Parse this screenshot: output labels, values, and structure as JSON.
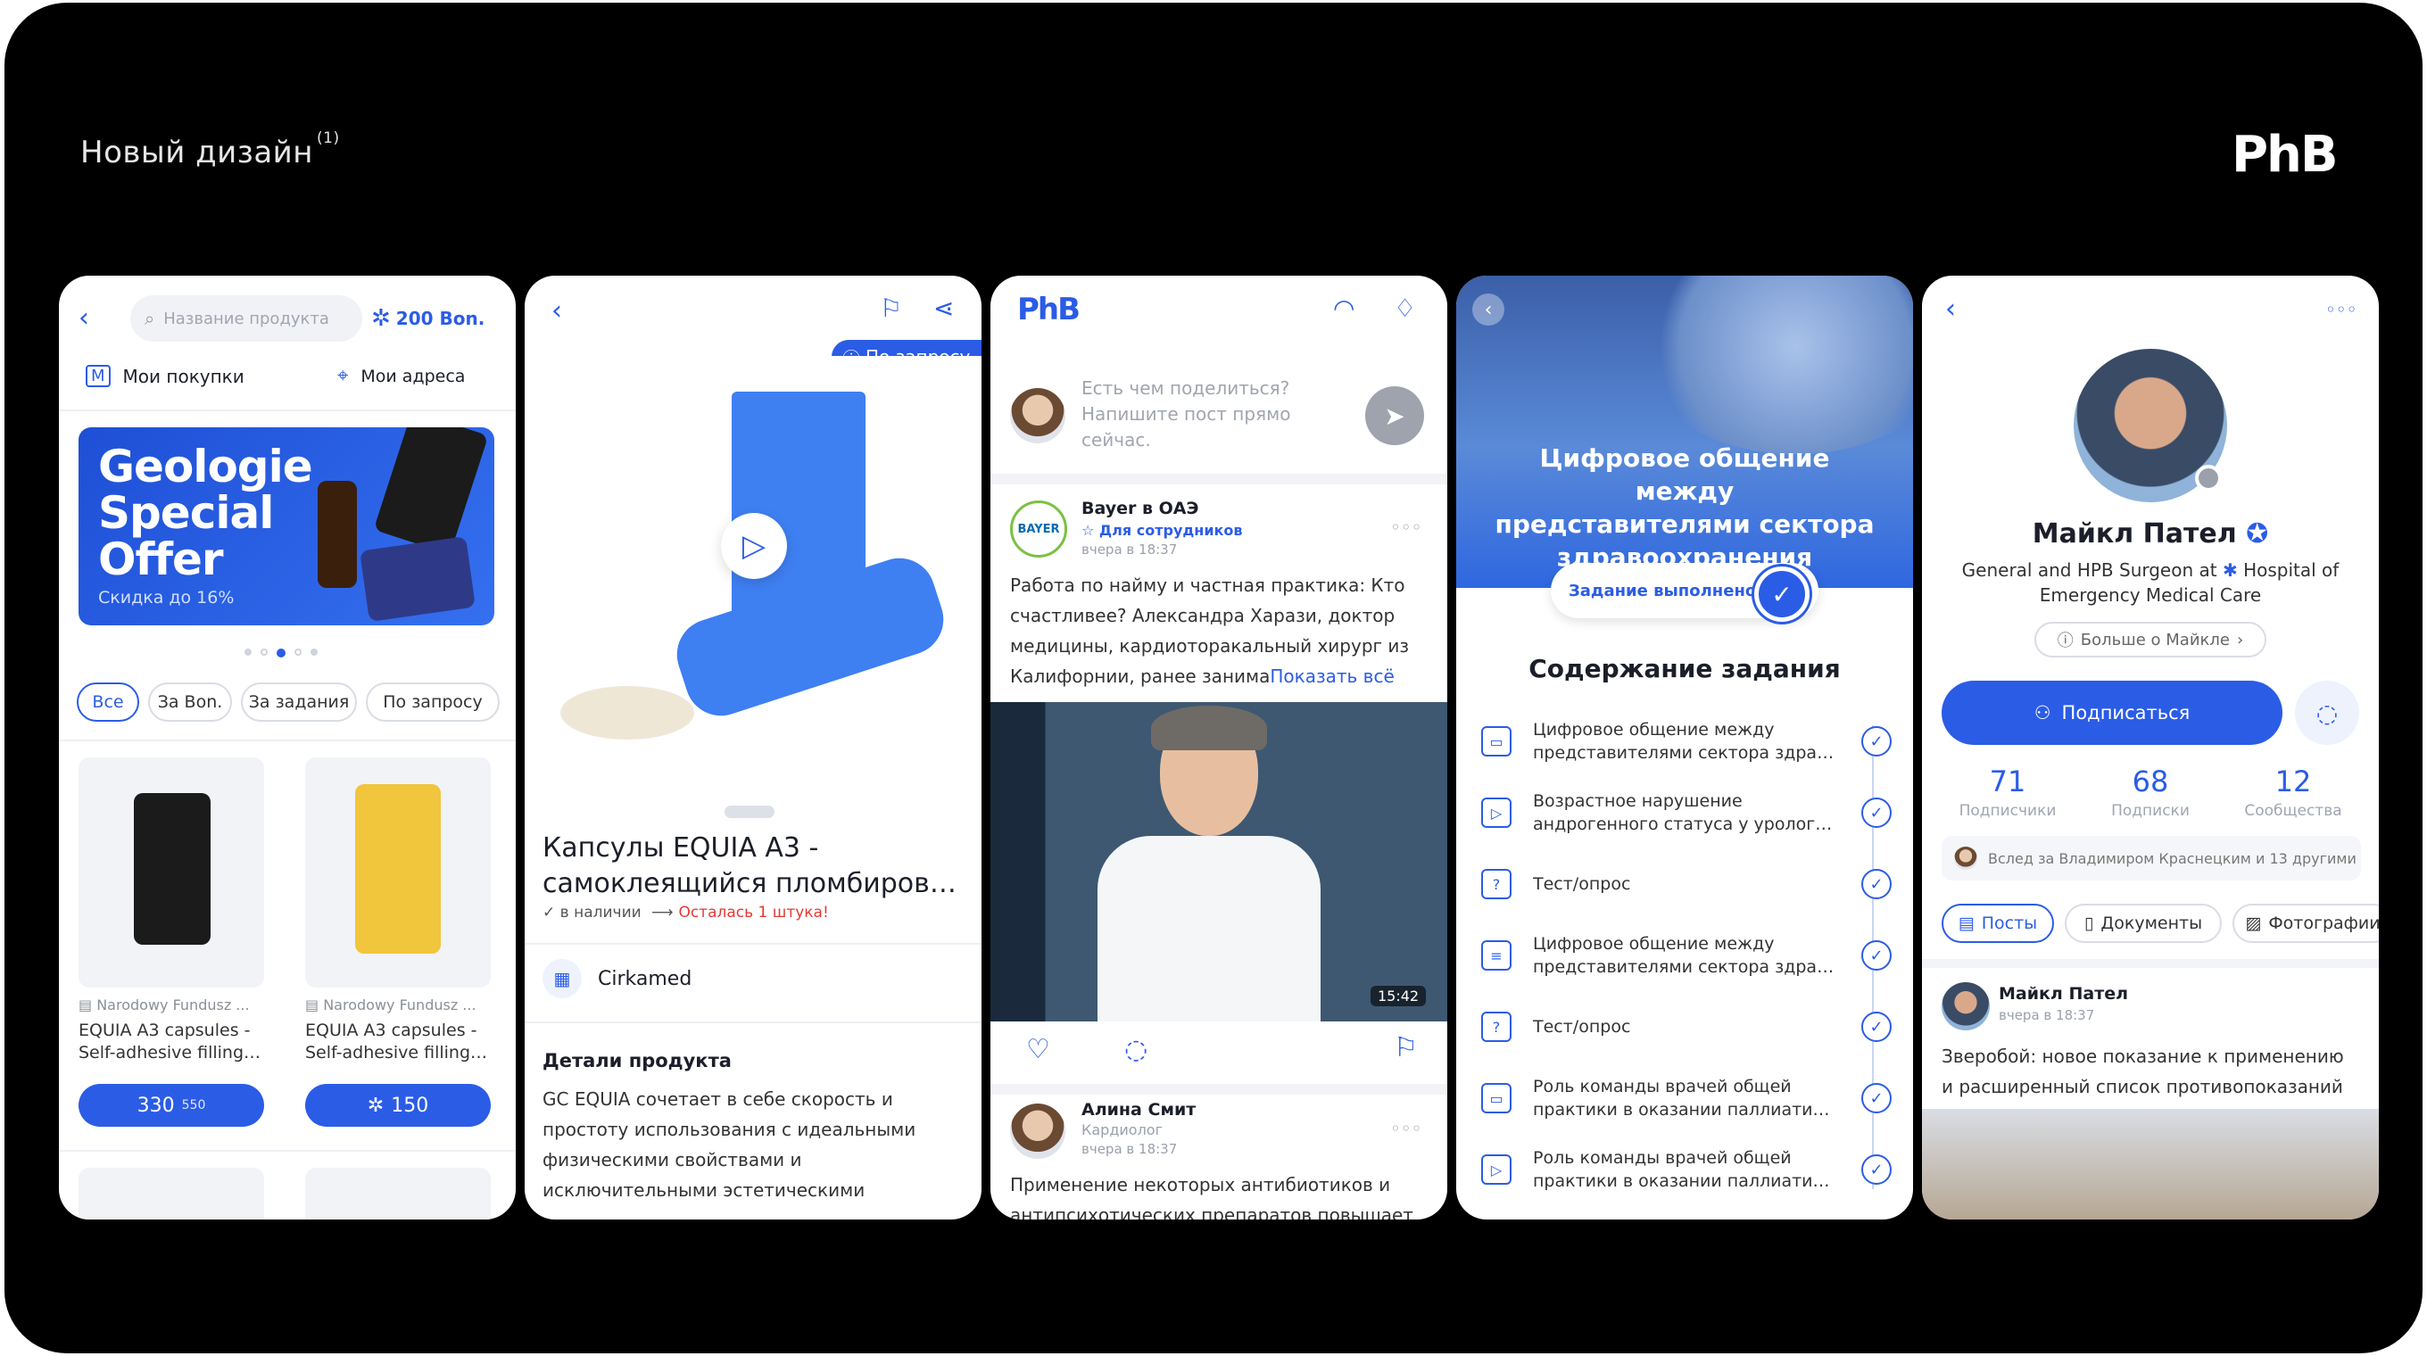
{
  "header": {
    "title": "Новый дизайн",
    "title_sup": "(1)",
    "brand": "PhB"
  },
  "p1": {
    "search_placeholder": "Название продукта",
    "bonus": "200 Bon.",
    "my_purchases": "Мои покупки",
    "my_addresses": "Мои адреса",
    "banner_title_1": "Geologie",
    "banner_title_2": "Special",
    "banner_title_3": "Offer",
    "banner_sub": "Скидка до 16%",
    "chips": [
      "Все",
      "За Bon.",
      "За задания",
      "По запросу"
    ],
    "products": [
      {
        "seller": "Narodowy Fundusz ...",
        "name_1": "EQUIA A3 capsules -",
        "name_2": "Self-adhesive filling ...",
        "price": "330",
        "price_old": "550"
      },
      {
        "seller": "Narodowy Fundusz ...",
        "name_1": "EQUIA A3 capsules -",
        "name_2": "Self-adhesive filling ...",
        "price": "150"
      }
    ]
  },
  "p2": {
    "on_request": "По запросу",
    "title_1": "Капсулы EQUIA A3 -",
    "title_2": "самоклеящийся пломбирово...",
    "in_stock": "в наличии",
    "left": "Осталась 1 штука!",
    "seller": "Cirkamed",
    "details_title": "Детали продукта",
    "details": [
      "GC EQUIA сочетает в себе скорость и",
      "простоту использования с идеальными",
      "физическими свойствами и",
      "исключительными эстетическими"
    ]
  },
  "p3": {
    "logo": "PhB",
    "composer": [
      "Есть чем поделиться?",
      "Напишите пост прямо",
      "сейчас."
    ],
    "post_author": "Bayer в ОАЭ",
    "post_audience": "Для сотрудников",
    "post_time": "вчера в 18:37",
    "post_text": [
      "Работа по найму и частная практика: Кто",
      "счастливее? Александра Харази, доктор",
      "медицины, кардиоторакальный хирург из",
      "Калифорнии, ранее занима"
    ],
    "show_all": "Показать всё",
    "video_duration": "15:42",
    "post2_author": "Алина Смит",
    "post2_role": "Кардиолог",
    "post2_time": "вчера в 18:37",
    "post2_text": [
      "Применение некоторых антибиотиков и",
      "антипсихотических препаратов повышает"
    ]
  },
  "p4": {
    "hero_title": [
      "Цифровое общение между",
      "представителями сектора",
      "здравоохранения"
    ],
    "status": "Задание выполнено",
    "section_title": "Содержание задания",
    "tasks": [
      {
        "icon": "▭",
        "l1": "Цифровое общение между",
        "l2": "представителями сектора здраво..."
      },
      {
        "icon": "▷",
        "l1": "Возрастное нарушение",
        "l2": "андрогенного статуса у урологич..."
      },
      {
        "icon": "?",
        "l1": "Тест/опрос",
        "l2": ""
      },
      {
        "icon": "≡",
        "l1": "Цифровое общение между",
        "l2": "представителями сектора здраво..."
      },
      {
        "icon": "?",
        "l1": "Тест/опрос",
        "l2": ""
      },
      {
        "icon": "▭",
        "l1": "Роль команды врачей общей",
        "l2": "практики в оказании паллиативн..."
      },
      {
        "icon": "▷",
        "l1": "Роль команды врачей общей",
        "l2": "практики в оказании паллиативн..."
      }
    ]
  },
  "p5": {
    "name": "Майкл Пател",
    "bio_1": "General and HPB Surgeon at",
    "bio_2": "Hospital of",
    "bio_3": "Emergency Medical Care",
    "more": "Больше о Майкле",
    "subscribe": "Подписаться",
    "stats": [
      {
        "n": "71",
        "l": "Подписчики"
      },
      {
        "n": "68",
        "l": "Подписки"
      },
      {
        "n": "12",
        "l": "Сообщества"
      }
    ],
    "followed_by": "Вслед за Владимиром Краснецким и 13 другими",
    "tabs": [
      "Посты",
      "Документы",
      "Фотографии"
    ],
    "post_author": "Майкл Пател",
    "post_time": "вчера в 18:37",
    "post_text": [
      "Зверобой: новое показание к применению",
      "и расширенный список противопоказаний"
    ]
  }
}
